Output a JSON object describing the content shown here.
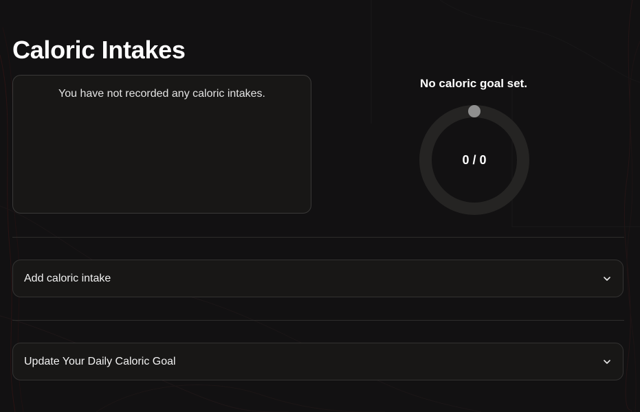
{
  "page": {
    "title": "Caloric Intakes"
  },
  "intakes": {
    "empty_message": "You have not recorded any caloric intakes."
  },
  "goal": {
    "status": "No caloric goal set.",
    "progress_text": "0 / 0",
    "consumed": 0,
    "target": 0
  },
  "accordions": [
    {
      "label": "Add caloric intake",
      "icon": "chevron-down-icon"
    },
    {
      "label": "Update Your Daily Caloric Goal",
      "icon": "chevron-down-icon"
    }
  ],
  "colors": {
    "background": "#121112",
    "card": "#181716",
    "border": "#3a3938",
    "ring_track": "#252423",
    "text": "#ffffff"
  }
}
